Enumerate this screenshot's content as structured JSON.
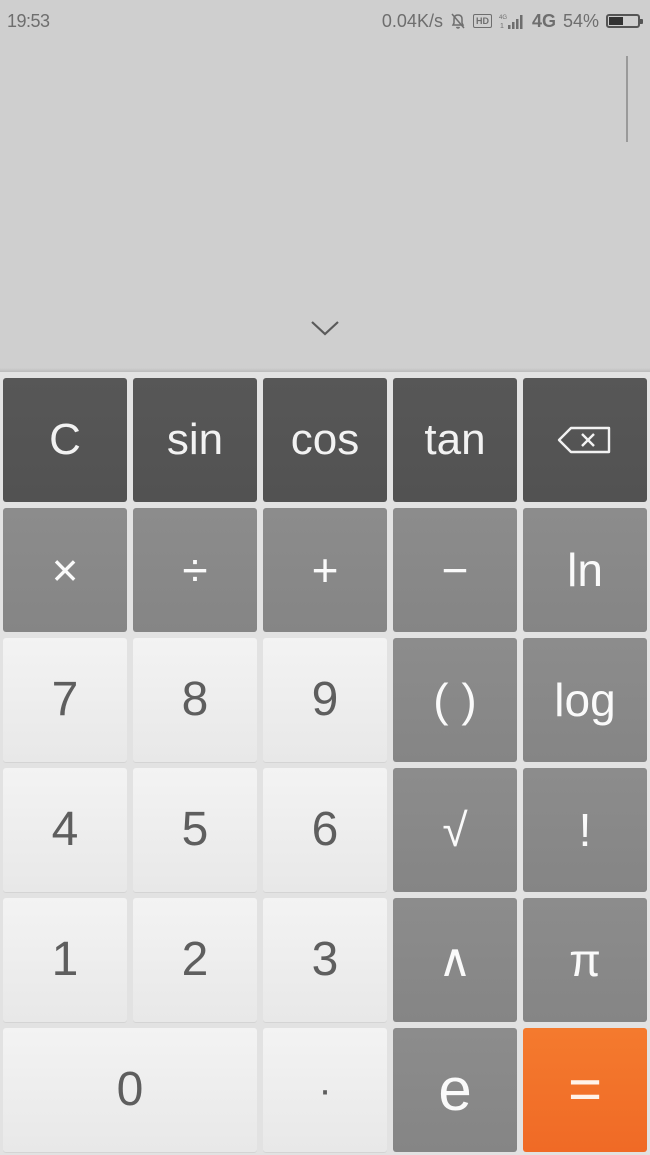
{
  "status_bar": {
    "time": "19:53",
    "network_speed": "0.04K/s",
    "icons": [
      "notifications-muted-icon",
      "hd-voice-icon",
      "dual-sim-signal-icon"
    ],
    "hd_label": "HD",
    "network_type": "4G",
    "battery_percent": "54%",
    "battery_level": 0.54
  },
  "display": {
    "expression": "",
    "collapse_icon": "chevron-down-icon"
  },
  "keypad": {
    "rows": [
      [
        {
          "label": "C",
          "name": "clear-button",
          "style": "dark"
        },
        {
          "label": "sin",
          "name": "sin-button",
          "style": "dark"
        },
        {
          "label": "cos",
          "name": "cos-button",
          "style": "dark"
        },
        {
          "label": "tan",
          "name": "tan-button",
          "style": "dark"
        },
        {
          "label": "",
          "name": "backspace-button",
          "style": "dark",
          "icon": "backspace-icon"
        }
      ],
      [
        {
          "label": "×",
          "name": "multiply-button",
          "style": "mid"
        },
        {
          "label": "÷",
          "name": "divide-button",
          "style": "mid"
        },
        {
          "label": "+",
          "name": "add-button",
          "style": "mid"
        },
        {
          "label": "−",
          "name": "subtract-button",
          "style": "mid"
        },
        {
          "label": "ln",
          "name": "ln-button",
          "style": "mid"
        }
      ],
      [
        {
          "label": "7",
          "name": "digit-7-button",
          "style": "light"
        },
        {
          "label": "8",
          "name": "digit-8-button",
          "style": "light"
        },
        {
          "label": "9",
          "name": "digit-9-button",
          "style": "light"
        },
        {
          "label": "( )",
          "name": "parentheses-button",
          "style": "mid"
        },
        {
          "label": "log",
          "name": "log-button",
          "style": "mid"
        }
      ],
      [
        {
          "label": "4",
          "name": "digit-4-button",
          "style": "light"
        },
        {
          "label": "5",
          "name": "digit-5-button",
          "style": "light"
        },
        {
          "label": "6",
          "name": "digit-6-button",
          "style": "light"
        },
        {
          "label": "√",
          "name": "sqrt-button",
          "style": "mid"
        },
        {
          "label": "!",
          "name": "factorial-button",
          "style": "mid"
        }
      ],
      [
        {
          "label": "1",
          "name": "digit-1-button",
          "style": "light"
        },
        {
          "label": "2",
          "name": "digit-2-button",
          "style": "light"
        },
        {
          "label": "3",
          "name": "digit-3-button",
          "style": "light"
        },
        {
          "label": "∧",
          "name": "power-button",
          "style": "mid"
        },
        {
          "label": "π",
          "name": "pi-button",
          "style": "mid"
        }
      ],
      [
        {
          "label": "0",
          "name": "digit-0-button",
          "style": "light",
          "wide": true
        },
        {
          "label": "·",
          "name": "decimal-point-button",
          "style": "light"
        },
        {
          "label": "e",
          "name": "euler-e-button",
          "style": "mid"
        },
        {
          "label": "=",
          "name": "equals-button",
          "style": "accent"
        }
      ]
    ]
  },
  "colors": {
    "accent": "#f26f29",
    "dark_key": "#555555",
    "mid_key": "#888888",
    "light_key": "#eeeeee",
    "background": "#cfcfcf"
  }
}
